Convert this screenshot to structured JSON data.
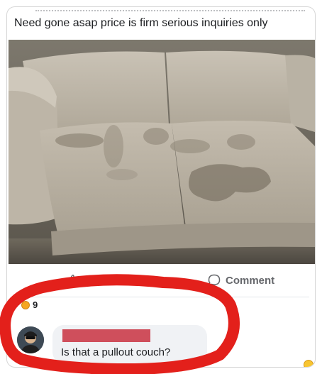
{
  "post": {
    "text": "Need gone asap price is firm serious inquiries only"
  },
  "actions": {
    "like_label": "Like",
    "comment_label": "Comment",
    "like_icon": "thumbs-up-icon",
    "comment_icon": "speech-bubble-icon"
  },
  "reactions": {
    "count": "9"
  },
  "comment": {
    "text": "Is that a pullout couch?",
    "author_redacted": true
  },
  "colors": {
    "annotation_red": "#e3201b",
    "redaction": "#cf4f5c",
    "action_gray": "#65676b"
  }
}
